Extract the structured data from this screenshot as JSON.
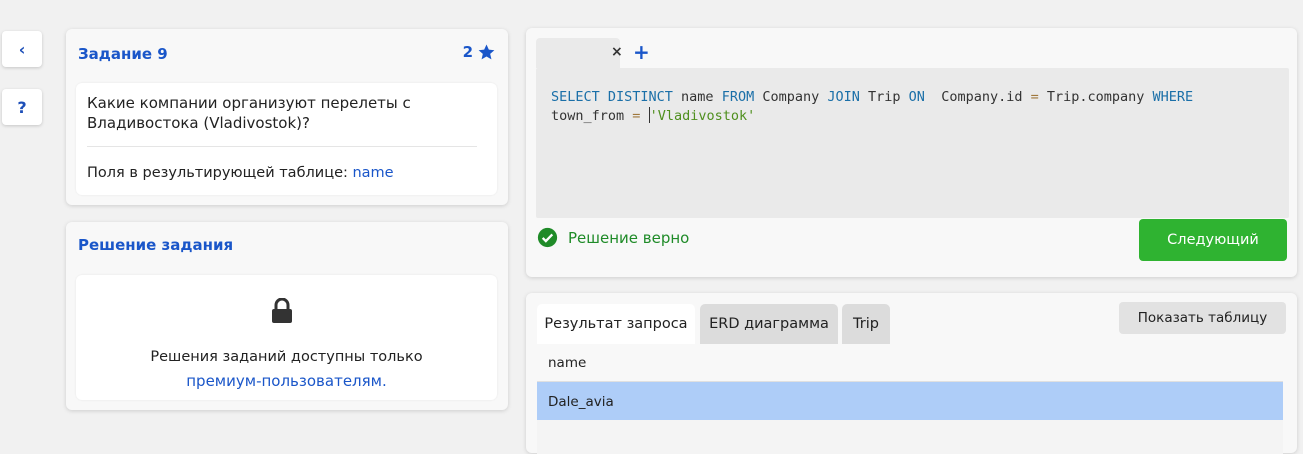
{
  "sidebar": {
    "back_label": "‹",
    "help_label": "?"
  },
  "task": {
    "title": "Задание 9",
    "rating": "2",
    "question": "Какие компании организуют перелеты с Владивостока (Vladivostok)?",
    "fields_label": "Поля в результирующей таблице:",
    "fields_value": "name"
  },
  "solution": {
    "title": "Решение задания",
    "locked_line1": "Решения заданий доступны только",
    "locked_link": "премиум-пользователям."
  },
  "editor": {
    "tab_close": "×",
    "tab_add": "+",
    "code": {
      "l1_kw1": "SELECT DISTINCT",
      "l1_t1": " name ",
      "l1_kw2": "FROM",
      "l1_t2": " Company ",
      "l1_kw3": "JOIN",
      "l1_t3": " Trip ",
      "l1_kw4": "ON",
      "l1_t4": "  Company.id ",
      "l1_op1": "=",
      "l1_t5": " Trip.company ",
      "l1_kw5": "WHERE",
      "l2_t1": "town_from ",
      "l2_op1": "=",
      "l2_t2": " ",
      "l2_str": "'Vladivostok'"
    },
    "status": "Решение верно",
    "next_button": "Следующий"
  },
  "results": {
    "tabs": [
      "Результат запроса",
      "ERD диаграмма",
      "Trip"
    ],
    "active_tab": "Результат запроса",
    "show_table_button": "Показать таблицу",
    "columns": [
      "name"
    ],
    "rows": [
      [
        "Dale_avia"
      ]
    ]
  },
  "colors": {
    "accent": "#1a56c9",
    "success": "#1f8b28",
    "button_green": "#2fb331",
    "selected_row": "#aecdf8"
  }
}
